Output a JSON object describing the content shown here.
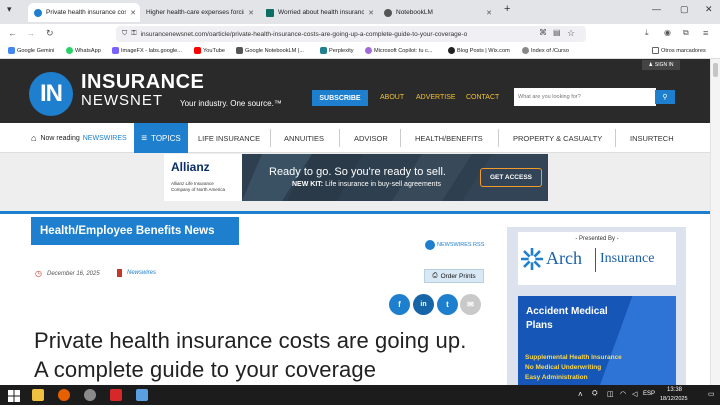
{
  "browser": {
    "tabs": [
      {
        "title": "Private health insurance costs a",
        "active": true,
        "color": "#1e7fcf"
      },
      {
        "title": "Higher health-care expenses forcing",
        "active": false,
        "color": "#f4a300"
      },
      {
        "title": "Worried about health insurance",
        "active": false,
        "color": "#0a6e62"
      },
      {
        "title": "NotebookLM",
        "active": false,
        "color": "#555555"
      }
    ],
    "url": "insurancenewsnet.com/oarticle/private-health-insurance-costs-are-going-up-a-complete-guide-to-your-coverage-o",
    "bookmarks": [
      {
        "label": "Google Gemini",
        "color": "#4285f4"
      },
      {
        "label": "WhatsApp",
        "color": "#25d366"
      },
      {
        "label": "ImageFX - labs.google...",
        "color": "#7b61ff"
      },
      {
        "label": "YouTube",
        "color": "#ff0000"
      },
      {
        "label": "Google NotebookLM |...",
        "color": "#555555"
      },
      {
        "label": "Perplexity",
        "color": "#20808d"
      },
      {
        "label": "Microsoft Copilot: tu c...",
        "color": "#a46bd6"
      },
      {
        "label": "Blog Posts | Wix.com",
        "color": "#222222"
      },
      {
        "label": "Index of /Curso",
        "color": "#888888"
      }
    ],
    "other_bookmarks": "Otros marcadores"
  },
  "header": {
    "logo_mark": "IN",
    "logo_insurance": "INSURANCE",
    "logo_newsnet": "NEWSNET",
    "tagline": "Your industry. One source.™",
    "signin": "SIGN IN",
    "subscribe": "SUBSCRIBE",
    "links": [
      "ABOUT",
      "ADVERTISE",
      "CONTACT"
    ],
    "search_placeholder": "What are you looking for?",
    "accent": "#1e7fcf",
    "link_color": "#f2c232"
  },
  "menu": {
    "now_reading": "Now reading",
    "now_reading_section": "NEWSWIRES",
    "topics": "TOPICS",
    "items": [
      "LIFE INSURANCE",
      "ANNUITIES",
      "ADVISOR",
      "HEALTH/BENEFITS",
      "PROPERTY & CASUALTY",
      "INSURTECH"
    ]
  },
  "ad": {
    "brand": "Allianz",
    "brand_sub1": "Allianz Life Insurance",
    "brand_sub2": "Company of North America",
    "headline": "Ready to go. So you're ready to sell.",
    "subline_bold": "NEW KIT:",
    "subline": "Life insurance in buy-sell agreements",
    "cta": "GET ACCESS"
  },
  "article": {
    "category": "Health/Employee Benefits News",
    "rss_label": "NEWSWIRES RSS",
    "date": "December 16, 2025",
    "author": "Newswires",
    "order_prints": "Order Prints",
    "share": [
      "f",
      "in",
      "t",
      "✉"
    ],
    "headline": "Private health insurance costs are going up. A complete guide to your coverage"
  },
  "sidebar": {
    "presented_by": "- Presented By -",
    "sponsor_name1": "Arch",
    "sponsor_name2": "Insurance",
    "ad_title": "Accident Medical Plans",
    "ad_lines": [
      "Supplemental Health Insurance",
      "No Medical Underwriting",
      "Easy Administration"
    ]
  },
  "taskbar": {
    "lang": "ESP",
    "time": "13:38",
    "date": "18/12/2025"
  }
}
